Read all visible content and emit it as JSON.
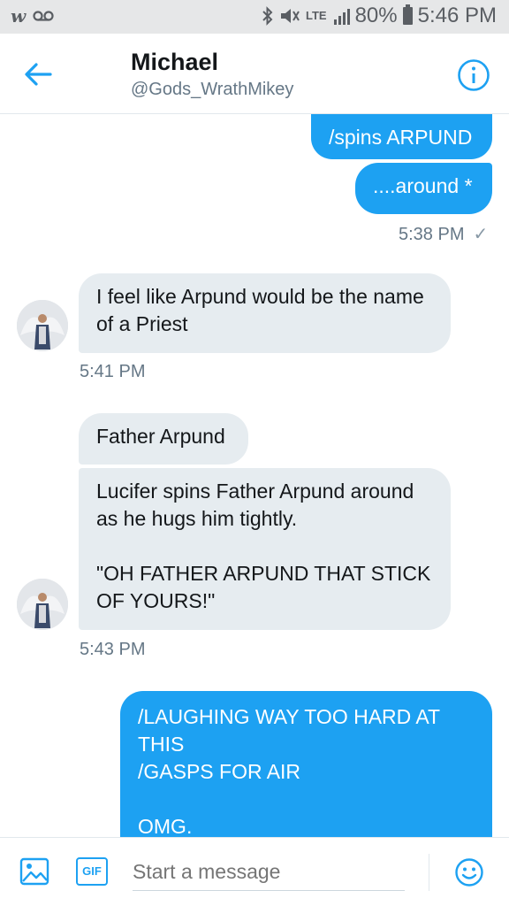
{
  "status_bar": {
    "left_icons": [
      "wattpad-icon",
      "voicemail-icon"
    ],
    "right_icons": [
      "bluetooth-icon",
      "mute-icon",
      "signal-icon"
    ],
    "network": "LTE",
    "battery": "80%",
    "time": "5:46 PM"
  },
  "header": {
    "name": "Michael",
    "handle": "@Gods_WrathMikey"
  },
  "messages": [
    {
      "from": "me",
      "text": "/spins ARPUND"
    },
    {
      "from": "me",
      "text": "....around *"
    },
    {
      "timestamp": "5:38 PM",
      "read": "✓"
    },
    {
      "from": "them",
      "text": "I feel like Arpund would be the name of a Priest"
    },
    {
      "timestamp": "5:41 PM"
    },
    {
      "from": "them",
      "text": "Father Arpund"
    },
    {
      "from": "them",
      "text": "Lucifer spins Father Arpund around as he hugs him tightly.\n\n\"OH FATHER ARPUND THAT STICK OF YOURS!\""
    },
    {
      "timestamp": "5:43 PM"
    },
    {
      "from": "me",
      "text": "/LAUGHING WAY TOO HARD AT THIS\n/GASPS FOR AIR\n\nOMG."
    }
  ],
  "composer": {
    "placeholder": "Start a message",
    "gif_label": "GIF"
  },
  "colors": {
    "accent": "#1da1f2",
    "received_bubble": "#e6ecf0",
    "secondary_text": "#657786"
  }
}
